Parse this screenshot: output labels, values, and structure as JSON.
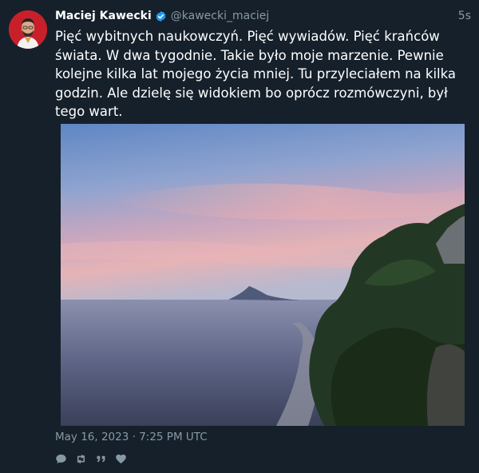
{
  "tweet": {
    "author_name": "Maciej Kawecki",
    "author_handle": "@kawecki_maciej",
    "time_ago": "5s",
    "text": "Pięć wybitnych naukowczyń. Pięć wywiadów. Pięć krańców świata. W dwa tygodnie. Takie było moje marzenie. Pewnie kolejne kilka lat mojego życia mniej. Tu przyleciałem na kilka godzin. Ale dzielę się widokiem bo oprócz rozmówczyni, był tego wart.",
    "timestamp": "May 16, 2023 · 7:25 PM UTC",
    "verified": true
  },
  "actions": [
    {
      "icon": "reply-icon"
    },
    {
      "icon": "retweet-icon"
    },
    {
      "icon": "quote-icon"
    },
    {
      "icon": "like-icon"
    }
  ],
  "colors": {
    "background": "#15202b",
    "secondary_text": "#8899a6",
    "verified_badge": "#1d9bf0"
  }
}
